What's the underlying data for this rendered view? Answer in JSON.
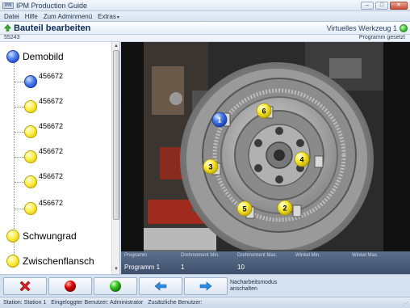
{
  "window": {
    "logo_text": "IPM",
    "title": "IPM Production Guide",
    "minimize": "–",
    "maximize": "□",
    "close": "✕"
  },
  "menu": {
    "items": [
      "Datei",
      "Hilfe",
      "Zum Adminmenü",
      "Extras"
    ],
    "extras_caret": "▾"
  },
  "header": {
    "title": "Bauteil bearbeiten",
    "tool_name": "Virtuelles Werkzeug 1",
    "tool_status_color": "#37c12b"
  },
  "subheader": {
    "part_id": "55243",
    "program_status": "Programm gesetzt"
  },
  "tree": {
    "root": {
      "label": "Demobild",
      "color": "blue"
    },
    "children": [
      {
        "label": "456672",
        "color": "blue"
      },
      {
        "label": "456672",
        "color": "yellow"
      },
      {
        "label": "456672",
        "color": "yellow"
      },
      {
        "label": "456672",
        "color": "yellow"
      },
      {
        "label": "456672",
        "color": "yellow"
      },
      {
        "label": "456672",
        "color": "yellow"
      }
    ],
    "siblings": [
      {
        "label": "Schwungrad",
        "color": "yellow"
      },
      {
        "label": "Zwischenflansch",
        "color": "yellow"
      }
    ],
    "scroll_up": "▲",
    "scroll_down": "▼"
  },
  "image": {
    "markers": [
      {
        "label": "1",
        "color": "blue"
      },
      {
        "label": "6",
        "color": "yellow"
      },
      {
        "label": "4",
        "color": "yellow"
      },
      {
        "label": "3",
        "color": "yellow"
      },
      {
        "label": "5",
        "color": "yellow"
      },
      {
        "label": "2",
        "color": "yellow"
      }
    ]
  },
  "program_table": {
    "headers": [
      "Programm",
      "Drehmoment Min.",
      "Drehmoment Max.",
      "Winkel Min.",
      "Winkel Max."
    ],
    "row": [
      "Programm 1",
      "1",
      "10",
      "",
      ""
    ]
  },
  "toolbar": {
    "buttons": [
      {
        "icon": "cancel-x-icon",
        "color": "#d42020"
      },
      {
        "icon": "red-light-icon",
        "color": "#d80000"
      },
      {
        "icon": "green-light-icon",
        "color": "#33c21f"
      },
      {
        "icon": "arrow-left-icon",
        "color": "#2b8be0"
      },
      {
        "icon": "arrow-right-icon",
        "color": "#2b8be0"
      }
    ],
    "rework_label": "Nacharbeitsmodus anschalten"
  },
  "status": {
    "station": "Station: Station 1",
    "user": "Eingeloggter Benutzer: Administrator",
    "extra_users": "Zusätzliche Benutzer:"
  }
}
